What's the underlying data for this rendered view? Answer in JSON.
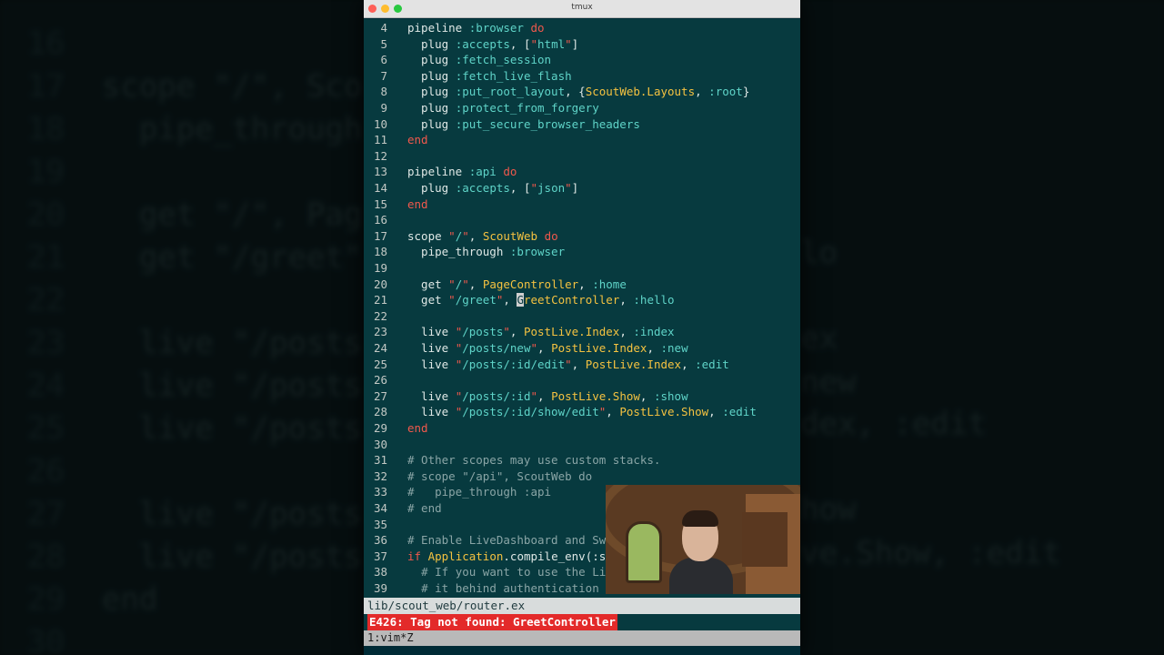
{
  "window": {
    "title": "tmux"
  },
  "background_lines": [
    {
      "num": "16",
      "text": ""
    },
    {
      "num": "17",
      "text": "scope \"/\", Sco"
    },
    {
      "num": "18",
      "text": "  pipe_through"
    },
    {
      "num": "19",
      "text": ""
    },
    {
      "num": "20",
      "text": "  get \"/\", Pag"
    },
    {
      "num": "21",
      "text": "  get \"/greet\""
    },
    {
      "num": "22",
      "text": ""
    },
    {
      "num": "23",
      "text": "  live \"/posts"
    },
    {
      "num": "24",
      "text": "  live \"/posts"
    },
    {
      "num": "25",
      "text": "  live \"/posts"
    },
    {
      "num": "26",
      "text": ""
    },
    {
      "num": "27",
      "text": "  live \"/posts"
    },
    {
      "num": "28",
      "text": "  live \"/posts"
    },
    {
      "num": "29",
      "text": "end"
    },
    {
      "num": "30",
      "text": ""
    }
  ],
  "background_right": [
    {
      "text": "lo"
    },
    {
      "text": "ex"
    },
    {
      "text": "new"
    },
    {
      "text": "dex, :edit"
    },
    {
      "text": "how"
    },
    {
      "text": "ve.Show, :edit"
    }
  ],
  "editor": {
    "lines": [
      {
        "n": "4",
        "html": "pipeline <span class='a'>:browser</span> <span class='k'>do</span>"
      },
      {
        "n": "5",
        "html": "  plug <span class='a'>:accepts</span>, [<span class='s'>\"</span><span class='a'>html</span><span class='s'>\"</span>]"
      },
      {
        "n": "6",
        "html": "  plug <span class='a'>:fetch_session</span>"
      },
      {
        "n": "7",
        "html": "  plug <span class='a'>:fetch_live_flash</span>"
      },
      {
        "n": "8",
        "html": "  plug <span class='a'>:put_root_layout</span>, {<span class='m'>ScoutWeb.Layouts</span>, <span class='a'>:root</span>}"
      },
      {
        "n": "9",
        "html": "  plug <span class='a'>:protect_from_forgery</span>"
      },
      {
        "n": "10",
        "html": "  plug <span class='a'>:put_secure_browser_headers</span>"
      },
      {
        "n": "11",
        "html": "<span class='k'>end</span>"
      },
      {
        "n": "12",
        "html": ""
      },
      {
        "n": "13",
        "html": "pipeline <span class='a'>:api</span> <span class='k'>do</span>"
      },
      {
        "n": "14",
        "html": "  plug <span class='a'>:accepts</span>, [<span class='s'>\"</span><span class='a'>json</span><span class='s'>\"</span>]"
      },
      {
        "n": "15",
        "html": "<span class='k'>end</span>"
      },
      {
        "n": "16",
        "html": ""
      },
      {
        "n": "17",
        "html": "scope <span class='s'>\"</span><span class='a'>/</span><span class='s'>\"</span>, <span class='m'>ScoutWeb</span> <span class='k'>do</span>"
      },
      {
        "n": "18",
        "html": "  pipe_through <span class='a'>:browser</span>"
      },
      {
        "n": "19",
        "html": ""
      },
      {
        "n": "20",
        "html": "  get <span class='s'>\"</span><span class='a'>/</span><span class='s'>\"</span>, <span class='m'>PageController</span>, <span class='a'>:home</span>"
      },
      {
        "n": "21",
        "html": "  get <span class='s'>\"</span><span class='a'>/greet</span><span class='s'>\"</span>, <span class='cursor'>G</span><span class='m'>reetController</span>, <span class='a'>:hello</span>"
      },
      {
        "n": "22",
        "html": ""
      },
      {
        "n": "23",
        "html": "  live <span class='s'>\"</span><span class='a'>/posts</span><span class='s'>\"</span>, <span class='m'>PostLive.Index</span>, <span class='a'>:index</span>"
      },
      {
        "n": "24",
        "html": "  live <span class='s'>\"</span><span class='a'>/posts/new</span><span class='s'>\"</span>, <span class='m'>PostLive.Index</span>, <span class='a'>:new</span>"
      },
      {
        "n": "25",
        "html": "  live <span class='s'>\"</span><span class='a'>/posts/:id/edit</span><span class='s'>\"</span>, <span class='m'>PostLive.Index</span>, <span class='a'>:edit</span>"
      },
      {
        "n": "26",
        "html": ""
      },
      {
        "n": "27",
        "html": "  live <span class='s'>\"</span><span class='a'>/posts/:id</span><span class='s'>\"</span>, <span class='m'>PostLive.Show</span>, <span class='a'>:show</span>"
      },
      {
        "n": "28",
        "html": "  live <span class='s'>\"</span><span class='a'>/posts/:id/show/edit</span><span class='s'>\"</span>, <span class='m'>PostLive.Show</span>, <span class='a'>:edit</span>"
      },
      {
        "n": "29",
        "html": "<span class='k'>end</span>"
      },
      {
        "n": "30",
        "html": ""
      },
      {
        "n": "31",
        "html": "<span class='c'># Other scopes may use custom stacks.</span>"
      },
      {
        "n": "32",
        "html": "<span class='c'># scope \"/api\", ScoutWeb do</span>"
      },
      {
        "n": "33",
        "html": "<span class='c'>#   pipe_through :api</span>"
      },
      {
        "n": "34",
        "html": "<span class='c'># end</span>"
      },
      {
        "n": "35",
        "html": ""
      },
      {
        "n": "36",
        "html": "<span class='c'># Enable LiveDashboard and Sw</span>"
      },
      {
        "n": "37",
        "html": "<span class='k'>if</span> <span class='m'>Application</span>.compile_env(:s"
      },
      {
        "n": "38",
        "html": "  <span class='c'># If you want to use the Li</span>"
      },
      {
        "n": "39",
        "html": "  <span class='c'># it behind authentication a</span>"
      }
    ]
  },
  "status": {
    "file": "lib/scout_web/router.ex",
    "error": "E426: Tag not found: GreetController",
    "tmux": "1:vim*Z"
  },
  "colors": {
    "editor_bg": "#073a3f",
    "keyword": "#f0584c",
    "atom": "#5fd4c8",
    "module": "#f4c240",
    "error_bg": "#e32a2a"
  }
}
